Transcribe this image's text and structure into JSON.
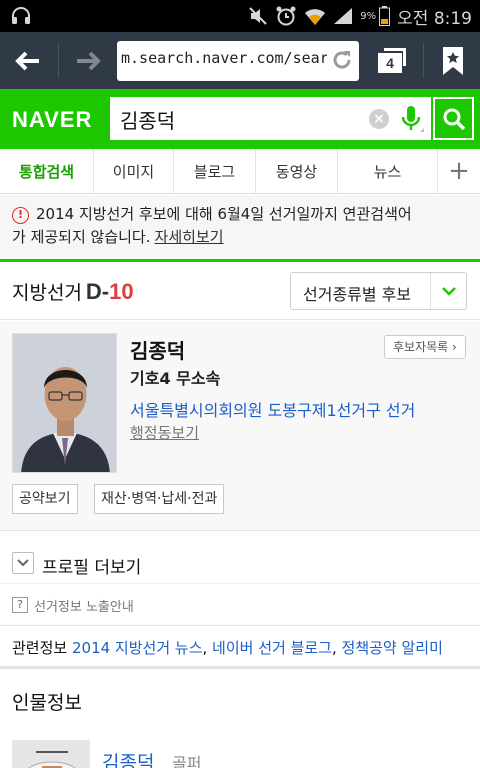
{
  "status_bar": {
    "battery_percent": "9%",
    "time": "오전 8:19",
    "icons": [
      "headset-icon",
      "mute-icon",
      "alarm-icon",
      "wifi-icon",
      "signal-icon",
      "battery-icon"
    ]
  },
  "browser": {
    "url": "m.search.naver.com/searc",
    "tab_count": "4",
    "icons": [
      "back-arrow-icon",
      "forward-arrow-icon",
      "refresh-icon",
      "tabs-icon",
      "bookmark-icon"
    ]
  },
  "naver": {
    "logo": "NAVER",
    "query": "김종덕",
    "clear_icon": "×",
    "brand_color": "#1ec800"
  },
  "tabs": [
    {
      "label": "통합검색",
      "active": true
    },
    {
      "label": "이미지",
      "active": false
    },
    {
      "label": "블로그",
      "active": false
    },
    {
      "label": "동영상",
      "active": false
    },
    {
      "label": "뉴스",
      "active": false
    }
  ],
  "tabs_more": "+",
  "notice": {
    "line1": "2014 지방선거 후보에 대해 6월4일 선거일까지 연관검색어",
    "line2": "가 제공되지 않습니다.",
    "link": "자세히보기",
    "icon": "!"
  },
  "election": {
    "title": "지방선거",
    "d_prefix": "D-",
    "d_number": "10",
    "dropdown_label": "선거종류별 후보"
  },
  "candidate": {
    "name": "김종덕",
    "party": "기호4 무소속",
    "district": "서울특별시의회의원 도봉구제1선거구 선거",
    "admin_link": "행정동보기",
    "list_button": "후보자목록 ›",
    "buttons": [
      "공약보기",
      "재산·병역·납세·전과"
    ]
  },
  "profile_more": "프로필 더보기",
  "election_info": "선거정보 노출안내",
  "election_info_icon": "?",
  "related": {
    "label": "관련정보",
    "links": [
      "2014 지방선거 뉴스",
      "네이버 선거 블로그",
      "정책공약 알리미"
    ],
    "separator": ", "
  },
  "person_info": {
    "title": "인물정보",
    "name": "김종덕",
    "role": "골퍼"
  }
}
